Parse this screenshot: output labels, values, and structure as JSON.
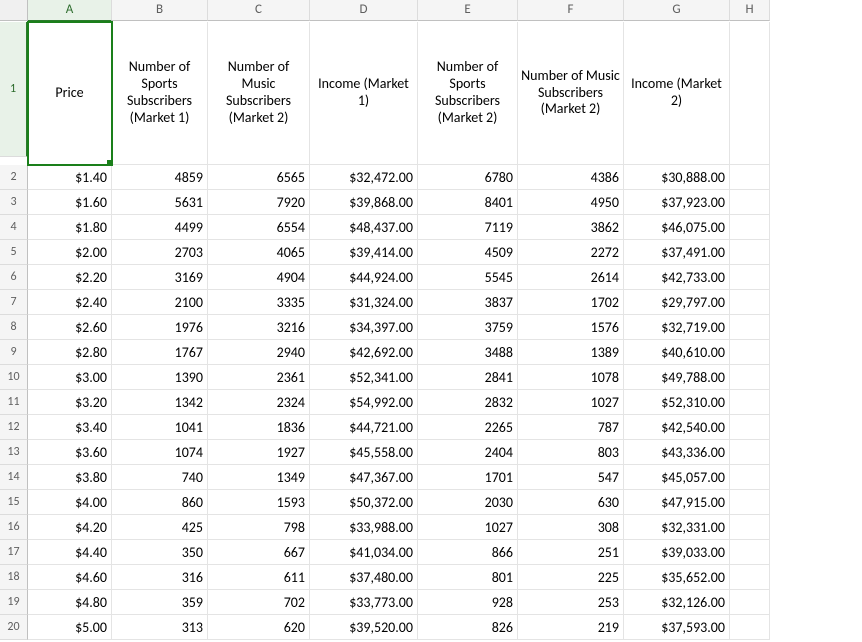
{
  "columns": [
    "A",
    "B",
    "C",
    "D",
    "E",
    "F",
    "G",
    "H"
  ],
  "active_cell": "A1",
  "active_col_index": 0,
  "active_row_index": 0,
  "headers": [
    "Price",
    "Number of Sports Subscribers (Market 1)",
    "Number of Music Subscribers (Market 2)",
    "Income (Market 1)",
    "Number of Sports Subscribers (Market 2)",
    "Number of Music Subscribers (Market 2)",
    "Income (Market 2)"
  ],
  "rows": [
    {
      "n": 2,
      "A": "$1.40",
      "B": "4859",
      "C": "6565",
      "D": "$32,472.00",
      "E": "6780",
      "F": "4386",
      "G": "$30,888.00"
    },
    {
      "n": 3,
      "A": "$1.60",
      "B": "5631",
      "C": "7920",
      "D": "$39,868.00",
      "E": "8401",
      "F": "4950",
      "G": "$37,923.00"
    },
    {
      "n": 4,
      "A": "$1.80",
      "B": "4499",
      "C": "6554",
      "D": "$48,437.00",
      "E": "7119",
      "F": "3862",
      "G": "$46,075.00"
    },
    {
      "n": 5,
      "A": "$2.00",
      "B": "2703",
      "C": "4065",
      "D": "$39,414.00",
      "E": "4509",
      "F": "2272",
      "G": "$37,491.00"
    },
    {
      "n": 6,
      "A": "$2.20",
      "B": "3169",
      "C": "4904",
      "D": "$44,924.00",
      "E": "5545",
      "F": "2614",
      "G": "$42,733.00"
    },
    {
      "n": 7,
      "A": "$2.40",
      "B": "2100",
      "C": "3335",
      "D": "$31,324.00",
      "E": "3837",
      "F": "1702",
      "G": "$29,797.00"
    },
    {
      "n": 8,
      "A": "$2.60",
      "B": "1976",
      "C": "3216",
      "D": "$34,397.00",
      "E": "3759",
      "F": "1576",
      "G": "$32,719.00"
    },
    {
      "n": 9,
      "A": "$2.80",
      "B": "1767",
      "C": "2940",
      "D": "$42,692.00",
      "E": "3488",
      "F": "1389",
      "G": "$40,610.00"
    },
    {
      "n": 10,
      "A": "$3.00",
      "B": "1390",
      "C": "2361",
      "D": "$52,341.00",
      "E": "2841",
      "F": "1078",
      "G": "$49,788.00"
    },
    {
      "n": 11,
      "A": "$3.20",
      "B": "1342",
      "C": "2324",
      "D": "$54,992.00",
      "E": "2832",
      "F": "1027",
      "G": "$52,310.00"
    },
    {
      "n": 12,
      "A": "$3.40",
      "B": "1041",
      "C": "1836",
      "D": "$44,721.00",
      "E": "2265",
      "F": "787",
      "G": "$42,540.00"
    },
    {
      "n": 13,
      "A": "$3.60",
      "B": "1074",
      "C": "1927",
      "D": "$45,558.00",
      "E": "2404",
      "F": "803",
      "G": "$43,336.00"
    },
    {
      "n": 14,
      "A": "$3.80",
      "B": "740",
      "C": "1349",
      "D": "$47,367.00",
      "E": "1701",
      "F": "547",
      "G": "$45,057.00"
    },
    {
      "n": 15,
      "A": "$4.00",
      "B": "860",
      "C": "1593",
      "D": "$50,372.00",
      "E": "2030",
      "F": "630",
      "G": "$47,915.00"
    },
    {
      "n": 16,
      "A": "$4.20",
      "B": "425",
      "C": "798",
      "D": "$33,988.00",
      "E": "1027",
      "F": "308",
      "G": "$32,331.00"
    },
    {
      "n": 17,
      "A": "$4.40",
      "B": "350",
      "C": "667",
      "D": "$41,034.00",
      "E": "866",
      "F": "251",
      "G": "$39,033.00"
    },
    {
      "n": 18,
      "A": "$4.60",
      "B": "316",
      "C": "611",
      "D": "$37,480.00",
      "E": "801",
      "F": "225",
      "G": "$35,652.00"
    },
    {
      "n": 19,
      "A": "$4.80",
      "B": "359",
      "C": "702",
      "D": "$33,773.00",
      "E": "928",
      "F": "253",
      "G": "$32,126.00"
    },
    {
      "n": 20,
      "A": "$5.00",
      "B": "313",
      "C": "620",
      "D": "$39,520.00",
      "E": "826",
      "F": "219",
      "G": "$37,593.00"
    }
  ]
}
